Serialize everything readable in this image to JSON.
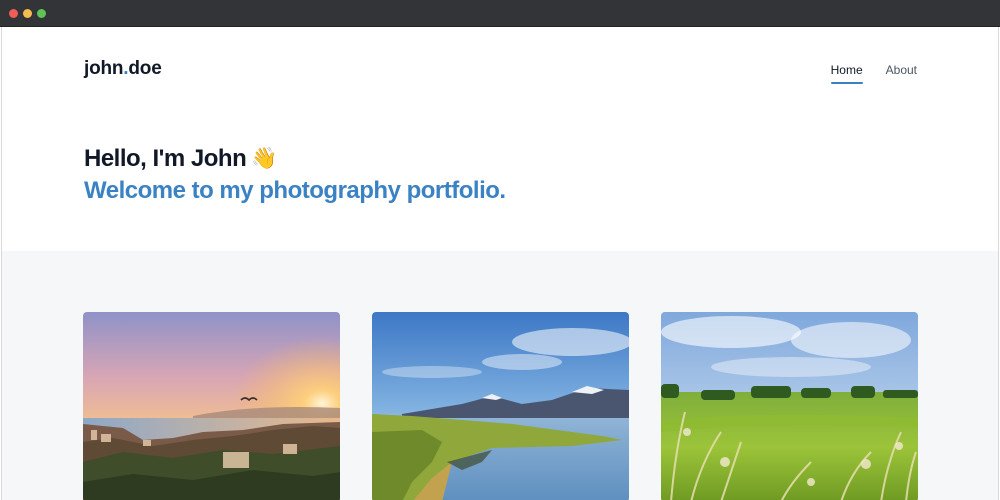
{
  "site": {
    "logo_part1": "john",
    "logo_dot": ".",
    "logo_part2": "doe"
  },
  "nav": {
    "items": [
      {
        "label": "Home",
        "active": true
      },
      {
        "label": "About",
        "active": false
      }
    ]
  },
  "hero": {
    "greeting": "Hello, I'm John",
    "wave_emoji": "👋",
    "subtitle": "Welcome to my photography portfolio."
  },
  "gallery": {
    "photos": [
      {
        "subject": "coastal city at sunset"
      },
      {
        "subject": "mountains and lake"
      },
      {
        "subject": "green meadow"
      }
    ]
  },
  "colors": {
    "accent": "#3b82c4",
    "text": "#111827",
    "window_bar": "#333437",
    "gallery_bg": "#f6f7f9"
  }
}
